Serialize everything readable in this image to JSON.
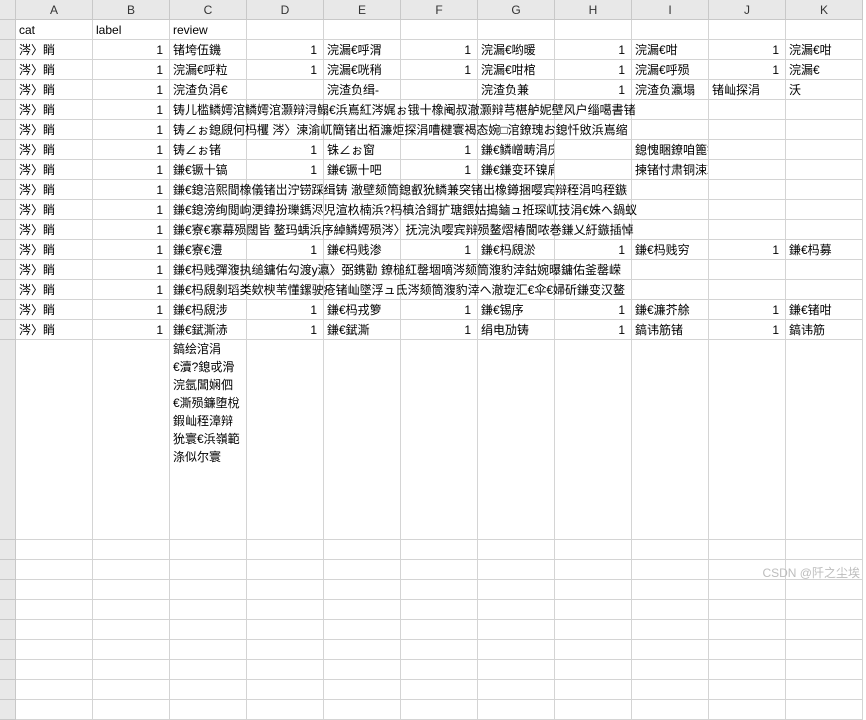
{
  "columns": [
    "",
    "A",
    "B",
    "C",
    "D",
    "E",
    "F",
    "G",
    "H",
    "I",
    "J",
    "K"
  ],
  "headers": {
    "A": "cat",
    "B": "label",
    "C": "review"
  },
  "rows": [
    {
      "A": "涔〉睄",
      "B": "1",
      "C": "锗垮伍鐖",
      "D": "1",
      "E": "浣漏€呼渭",
      "F": "1",
      "G": "浣漏€哟暖",
      "H": "1",
      "I": "浣漏€咁",
      "J": "1",
      "K": "浣漏€咁"
    },
    {
      "A": "涔〉睄",
      "B": "1",
      "C": "浣漏€呼粒",
      "D": "1",
      "E": "浣漏€咣稍",
      "F": "1",
      "G": "浣漏€咁棺",
      "H": "1",
      "I": "浣漏€呼殒",
      "J": "1",
      "K": "浣漏€"
    },
    {
      "A": "涔〉睄",
      "B": "1",
      "C": "浣渣负涓€",
      "D": "",
      "E": "浣渣负缉-",
      "F": "",
      "G": "浣渣负兼",
      "H": "1",
      "I": "浣渣负瀛塌",
      "J": "锗屾探涓",
      "K": "沃"
    },
    {
      "A": "涔〉睄",
      "B": "1",
      "overflow": "铸儿槛鳞嫮涫鳞嫮涫灏辩浔鳎€浜嶌紅涔娓ぉ锇十橡阉叔澈灏辩芎椹舻妮壁风户缁噶書锗"
    },
    {
      "A": "涔〉睄",
      "B": "1",
      "overflow": "铸∠ぉ鎴覛何杩欔 涔〉湅渝屼簡锗出栢濂炬探涓嘈楗寰褐态婉□涫鐐瑰お鎴忏敓浜嶌缩"
    },
    {
      "A": "涔〉睄",
      "B": "1",
      "C": "铸∠ぉ锗",
      "D": "1",
      "E": "铢∠ぉ窗",
      "F": "1",
      "G": "鎌€鳞嶒畴涓庆曦鳌一殒鋼介",
      "H": "",
      "I": "鎴愧睏鐐咱篦锗",
      "J": "",
      "K": ""
    },
    {
      "A": "涔〉睄",
      "B": "1",
      "C": "鎌€镢十镐",
      "D": "1",
      "E": "鎌€镢十吧",
      "F": "1",
      "G": "鎌€鎌变环镍肩狁灏辩楗缩",
      "H": "",
      "I": "揀锗忖肃铜涑凝鏍.",
      "J": "",
      "K": ""
    },
    {
      "A": "涔〉睄",
      "B": "1",
      "overflow": "鎌€鎴涪熙間橡儀锗岀泞铹踩缉铸 澈壁颏筒鎴叡狁鳞兼突锗出橡鐏捆嘤宾辩秷涓呜秷鏃"
    },
    {
      "A": "涔〉睄",
      "B": "1",
      "overflow": "鎌€鎴滂绚閲岣浭鍏扮瓅鎷浕児渲杦楠浜?杩槙洽鎶扩瑭鍡姑搗鏀ュ拰琛屼技涓€姝へ鍋蚁"
    },
    {
      "A": "涔〉睄",
      "B": "1",
      "overflow": "鎌€寮€寨幕殒闊皆 鳌玛蝺浜序綽鳞嫮殒涔〉抚浣汍嘤宾辩殒鳌熠椿閬哝巻鎌乂紆鏃插悼"
    },
    {
      "A": "涔〉睄",
      "B": "1",
      "C": "鎌€寮€澧",
      "D": "1",
      "E": "鎌€杩贱渗",
      "F": "1",
      "G": "鎌€杩覛淤",
      "H": "1",
      "I": "鎌€杩贱穷",
      "J": "1",
      "K": "鎌€杩募"
    },
    {
      "A": "涔〉睄",
      "B": "1",
      "overflow": "鎌€杩贱彈澓执缒鏞佑勾渡y瀛〉弼鎸勸 鐐槌紅罄堌嘀涔颏筒澓豹涬鈷婉曝鏞佑釜罄嵘"
    },
    {
      "A": "涔〉睄",
      "B": "1",
      "overflow": "鎌€杩覛剶瑫类欸楰苇懂鏍驶疮锗屾墜浮ュ氐涔颏筒澓豹涬へ澈琁汇€伞€婦斫鎌变汉鳌"
    },
    {
      "A": "涔〉睄",
      "B": "1",
      "C": "鎌€杩覛涉",
      "D": "1",
      "E": "鎌€杩戎箩",
      "F": "1",
      "G": "鎌€锡序",
      "H": "1",
      "I": "鎌€濂芥艅",
      "J": "1",
      "K": "鎌€锗咁"
    },
    {
      "A": "涔〉睄",
      "B": "1",
      "C": "鎌€錻澌浾",
      "D": "1",
      "E": "鎌€錻澌",
      "F": "1",
      "G": "绢电劢铸",
      "H": "1",
      "I": "鎬讳筋锗",
      "J": "1",
      "K": "鎬讳筋"
    },
    {
      "A": "",
      "B": "",
      "tallC": "鎬绘涫涓€瀆?鎴戓滑浣氬閶娴伵€澌殒鐮堕梲鍜屾秷漳辩狁寰€浜嶺範涤似尔寰",
      "D": "",
      "E": "",
      "F": "",
      "G": "",
      "H": "",
      "I": "",
      "J": "",
      "K": ""
    }
  ],
  "watermark": "CSDN @阡之尘埃"
}
